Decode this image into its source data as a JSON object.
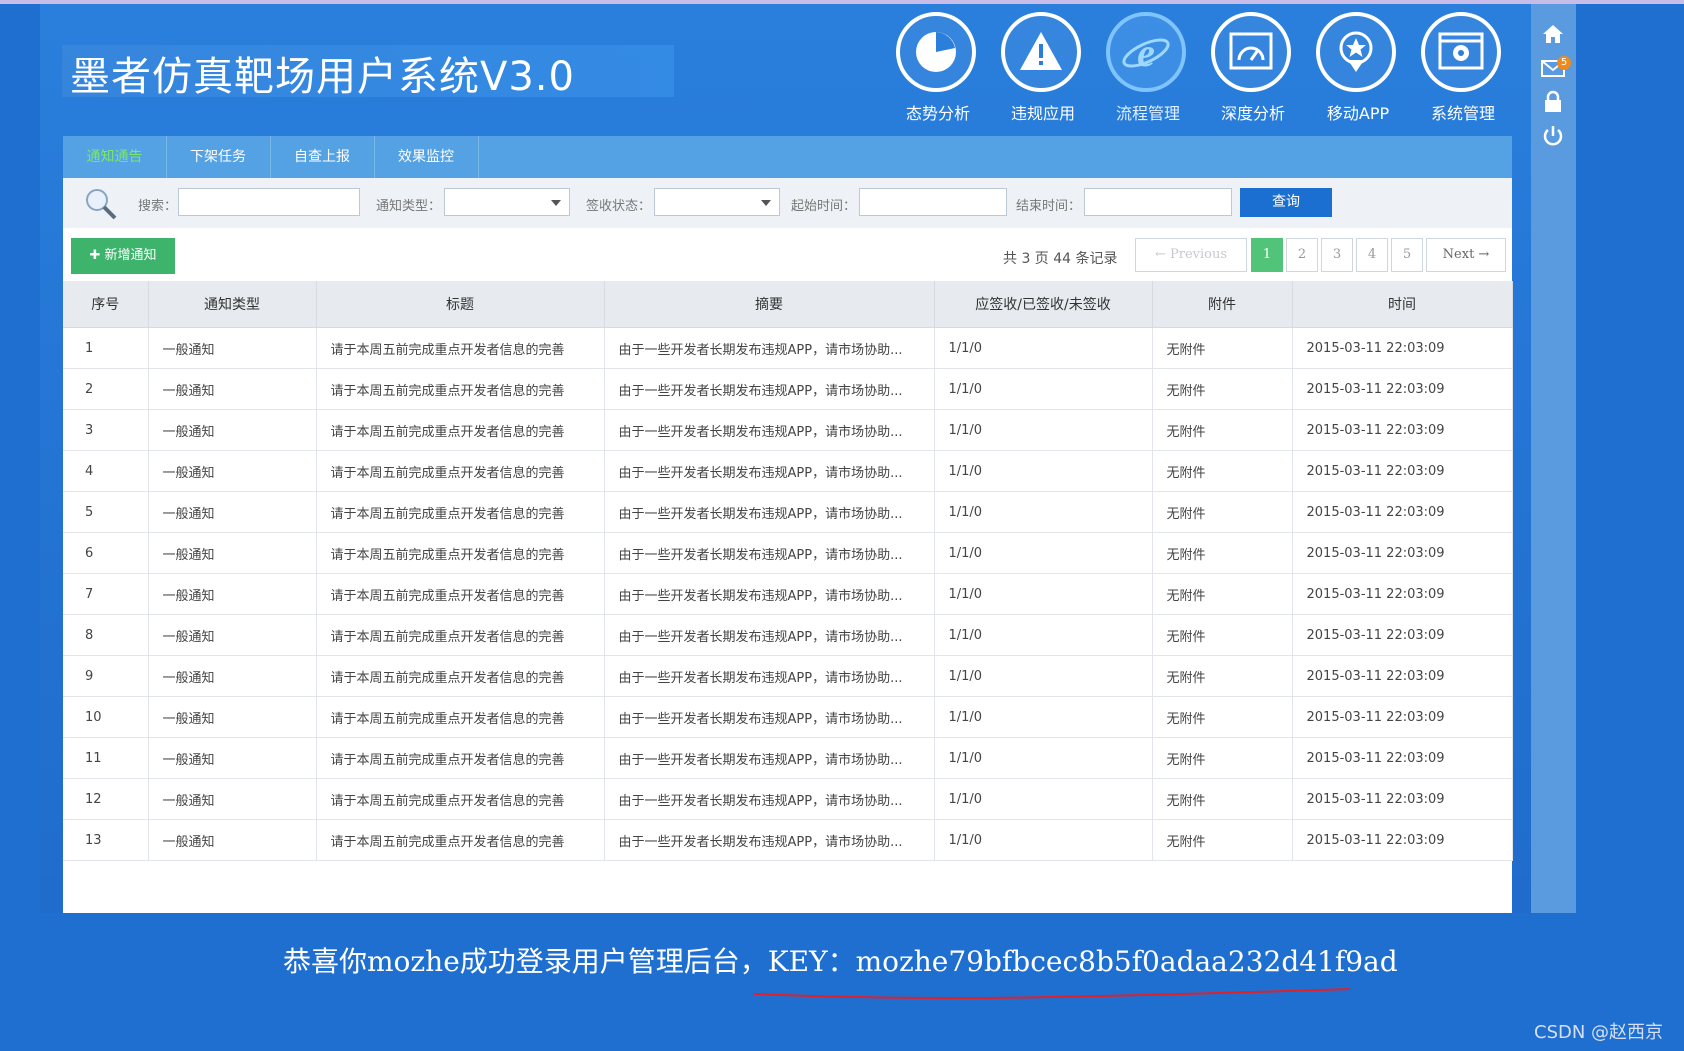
{
  "app": {
    "title": "墨者仿真靶场用户系统V3.0"
  },
  "nav": [
    {
      "label": "态势分析",
      "icon": "pie-chart-icon"
    },
    {
      "label": "违规应用",
      "icon": "warning-icon"
    },
    {
      "label": "流程管理",
      "icon": "ie-icon"
    },
    {
      "label": "深度分析",
      "icon": "gauge-icon"
    },
    {
      "label": "移动APP",
      "icon": "star-icon"
    },
    {
      "label": "系统管理",
      "icon": "gear-window-icon"
    }
  ],
  "side": {
    "mail_badge": "5"
  },
  "subnav": [
    "通知通告",
    "下架任务",
    "自查上报",
    "效果监控"
  ],
  "filters": {
    "search_label": "搜索：",
    "type_label": "通知类型：",
    "sign_label": "签收状态：",
    "start_label": "起始时间：",
    "end_label": "结束时间：",
    "query_button": "查询"
  },
  "toolbar": {
    "add_button": "新增通知",
    "page_info": "共 3 页 44 条记录",
    "prev": "← Previous",
    "pages": [
      "1",
      "2",
      "3",
      "4",
      "5"
    ],
    "next": "Next →"
  },
  "table": {
    "columns": [
      "序号",
      "通知类型",
      "标题",
      "摘要",
      "应签收/已签收/未签收",
      "附件",
      "时间"
    ],
    "rows": [
      [
        "1",
        "一般通知",
        "请于本周五前完成重点开发者信息的完善",
        "由于一些开发者长期发布违规APP，请市场协助...",
        "1/1/0",
        "无附件",
        "2015-03-11 22:03:09"
      ],
      [
        "2",
        "一般通知",
        "请于本周五前完成重点开发者信息的完善",
        "由于一些开发者长期发布违规APP，请市场协助...",
        "1/1/0",
        "无附件",
        "2015-03-11 22:03:09"
      ],
      [
        "3",
        "一般通知",
        "请于本周五前完成重点开发者信息的完善",
        "由于一些开发者长期发布违规APP，请市场协助...",
        "1/1/0",
        "无附件",
        "2015-03-11 22:03:09"
      ],
      [
        "4",
        "一般通知",
        "请于本周五前完成重点开发者信息的完善",
        "由于一些开发者长期发布违规APP，请市场协助...",
        "1/1/0",
        "无附件",
        "2015-03-11 22:03:09"
      ],
      [
        "5",
        "一般通知",
        "请于本周五前完成重点开发者信息的完善",
        "由于一些开发者长期发布违规APP，请市场协助...",
        "1/1/0",
        "无附件",
        "2015-03-11 22:03:09"
      ],
      [
        "6",
        "一般通知",
        "请于本周五前完成重点开发者信息的完善",
        "由于一些开发者长期发布违规APP，请市场协助...",
        "1/1/0",
        "无附件",
        "2015-03-11 22:03:09"
      ],
      [
        "7",
        "一般通知",
        "请于本周五前完成重点开发者信息的完善",
        "由于一些开发者长期发布违规APP，请市场协助...",
        "1/1/0",
        "无附件",
        "2015-03-11 22:03:09"
      ],
      [
        "8",
        "一般通知",
        "请于本周五前完成重点开发者信息的完善",
        "由于一些开发者长期发布违规APP，请市场协助...",
        "1/1/0",
        "无附件",
        "2015-03-11 22:03:09"
      ],
      [
        "9",
        "一般通知",
        "请于本周五前完成重点开发者信息的完善",
        "由于一些开发者长期发布违规APP，请市场协助...",
        "1/1/0",
        "无附件",
        "2015-03-11 22:03:09"
      ],
      [
        "10",
        "一般通知",
        "请于本周五前完成重点开发者信息的完善",
        "由于一些开发者长期发布违规APP，请市场协助...",
        "1/1/0",
        "无附件",
        "2015-03-11 22:03:09"
      ],
      [
        "11",
        "一般通知",
        "请于本周五前完成重点开发者信息的完善",
        "由于一些开发者长期发布违规APP，请市场协助...",
        "1/1/0",
        "无附件",
        "2015-03-11 22:03:09"
      ],
      [
        "12",
        "一般通知",
        "请于本周五前完成重点开发者信息的完善",
        "由于一些开发者长期发布违规APP，请市场协助...",
        "1/1/0",
        "无附件",
        "2015-03-11 22:03:09"
      ],
      [
        "13",
        "一般通知",
        "请于本周五前完成重点开发者信息的完善",
        "由于一些开发者长期发布违规APP，请市场协助...",
        "1/1/0",
        "无附件",
        "2015-03-11 22:03:09"
      ]
    ]
  },
  "footer": {
    "message": "恭喜你mozhe成功登录用户管理后台，KEY：mozhe79bfbcec8b5f0adaa232d41f9ad",
    "watermark": "CSDN @赵西京"
  },
  "colors": {
    "background": "#1f6fd1",
    "subnav": "#54a2e3",
    "active_tab": "#79e86a",
    "add_button": "#3db36b",
    "query_button": "#1b6fd0",
    "annotation_line": "#e0202a"
  }
}
